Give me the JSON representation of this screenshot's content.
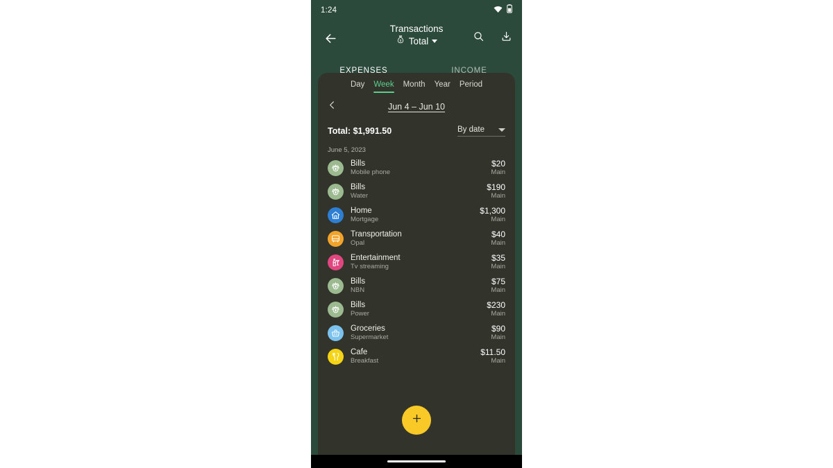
{
  "status_bar": {
    "time": "1:24",
    "wifi_icon": "wifi-icon",
    "battery_icon": "battery-icon"
  },
  "app_bar": {
    "back_icon": "back-arrow-icon",
    "title": "Transactions",
    "account_icon": "money-bag-icon",
    "account_label": "Total",
    "dropdown_icon": "chevron-down-icon",
    "search_icon": "search-icon",
    "export_icon": "download-icon"
  },
  "tabs": [
    {
      "label": "EXPENSES",
      "active": true
    },
    {
      "label": "INCOME",
      "active": false
    }
  ],
  "ranges": [
    {
      "label": "Day",
      "active": false
    },
    {
      "label": "Week",
      "active": true
    },
    {
      "label": "Month",
      "active": false
    },
    {
      "label": "Year",
      "active": false
    },
    {
      "label": "Period",
      "active": false
    }
  ],
  "date_nav": {
    "prev_icon": "chevron-left-icon",
    "range": "Jun 4 – Jun 10"
  },
  "summary": {
    "total_label": "Total: $1,991.50",
    "sort_label": "By date",
    "sort_caret_icon": "chevron-down-icon"
  },
  "groups": [
    {
      "date": "June 5, 2023",
      "transactions": [
        {
          "category": "Bills",
          "note": "Mobile phone",
          "amount": "$20",
          "account": "Main",
          "icon": "bills-icon",
          "color": "#9cba90"
        },
        {
          "category": "Bills",
          "note": "Water",
          "amount": "$190",
          "account": "Main",
          "icon": "bills-icon",
          "color": "#9cba90"
        },
        {
          "category": "Home",
          "note": "Mortgage",
          "amount": "$1,300",
          "account": "Main",
          "icon": "home-icon",
          "color": "#2d7fd4"
        },
        {
          "category": "Transportation",
          "note": "Opal",
          "amount": "$40",
          "account": "Main",
          "icon": "bus-icon",
          "color": "#f2a32a"
        },
        {
          "category": "Entertainment",
          "note": "Tv streaming",
          "amount": "$35",
          "account": "Main",
          "icon": "drinks-icon",
          "color": "#e0467f"
        },
        {
          "category": "Bills",
          "note": "NBN",
          "amount": "$75",
          "account": "Main",
          "icon": "bills-icon",
          "color": "#9cba90"
        },
        {
          "category": "Bills",
          "note": "Power",
          "amount": "$230",
          "account": "Main",
          "icon": "bills-icon",
          "color": "#9cba90"
        },
        {
          "category": "Groceries",
          "note": "Supermarket",
          "amount": "$90",
          "account": "Main",
          "icon": "basket-icon",
          "color": "#7cc2ef"
        },
        {
          "category": "Cafe",
          "note": "Breakfast",
          "amount": "$11.50",
          "account": "Main",
          "icon": "cutlery-icon",
          "color": "#f5d415"
        }
      ]
    }
  ],
  "fab": {
    "label": "+",
    "icon": "plus-icon",
    "color": "#f8c927"
  },
  "theme": {
    "header_green": "#2b4a3b",
    "card_dark": "#32342c",
    "accent_green": "#5bcf8d",
    "amber": "#f8c927"
  }
}
